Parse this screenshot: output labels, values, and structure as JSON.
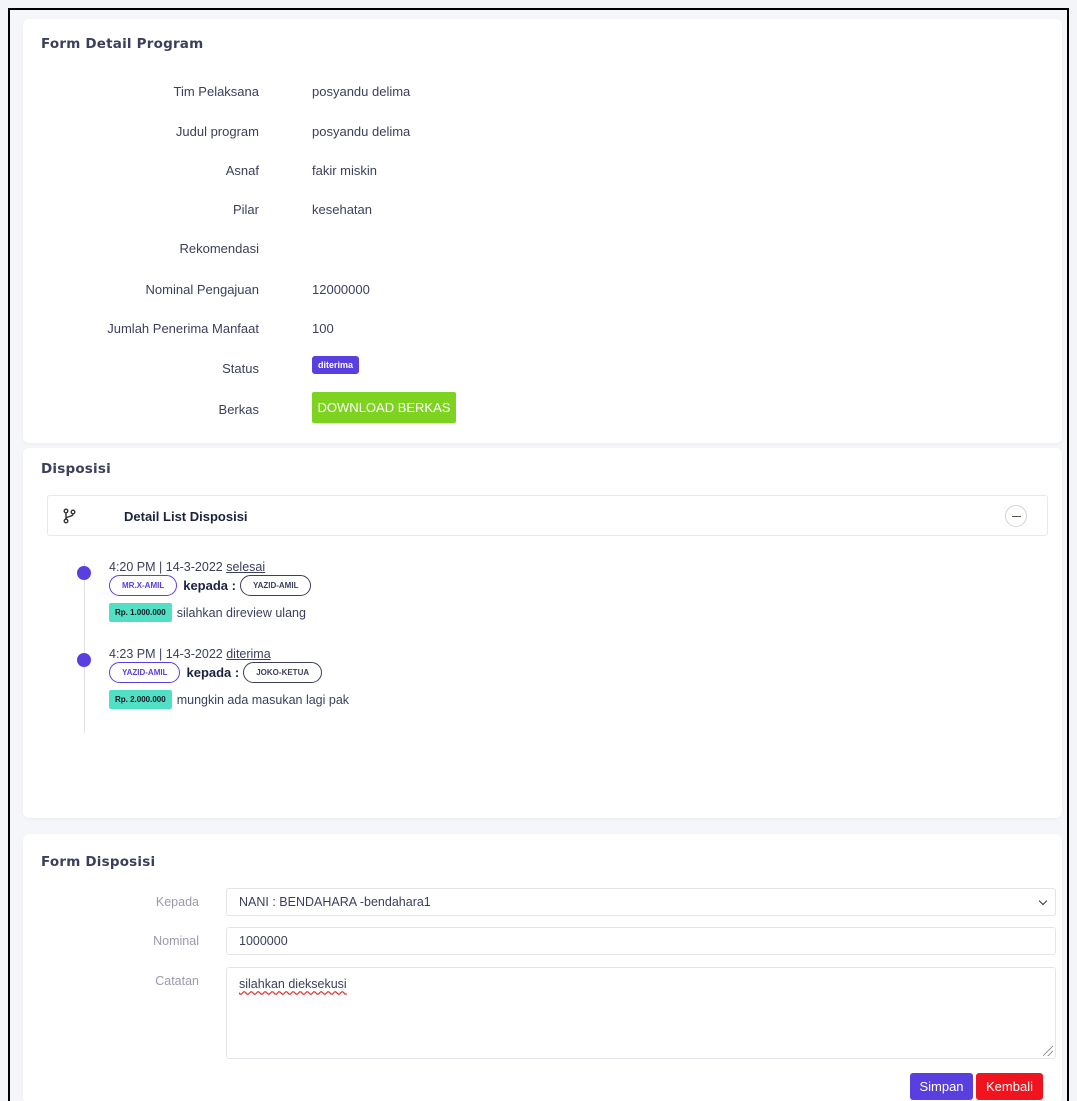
{
  "detail": {
    "title": "Form Detail Program",
    "rows": [
      {
        "label": "Tim Pelaksana",
        "value": "posyandu delima"
      },
      {
        "label": "Judul program",
        "value": "posyandu delima"
      },
      {
        "label": "Asnaf",
        "value": "fakir miskin"
      },
      {
        "label": "Pilar",
        "value": "kesehatan"
      },
      {
        "label": "Rekomendasi",
        "value": ""
      },
      {
        "label": "Nominal Pengajuan",
        "value": "12000000"
      },
      {
        "label": "Jumlah Penerima Manfaat",
        "value": "100"
      }
    ],
    "status_label": "Status",
    "status_value": "diterima",
    "berkas_label": "Berkas",
    "download_label": "DOWNLOAD BERKAS"
  },
  "disposisi": {
    "title": "Disposisi",
    "accordion_title": "Detail List Disposisi",
    "kepada_text": "kepada :",
    "items": [
      {
        "time": "4:20 PM | 14-3-2022",
        "status": "selesai",
        "from": "MR.X-AMIL",
        "to": "YAZID-AMIL",
        "amount": "Rp. 1.000.000",
        "note": "silahkan direview ulang"
      },
      {
        "time": "4:23 PM | 14-3-2022",
        "status": "diterima",
        "from": "YAZID-AMIL",
        "to": "JOKO-KETUA",
        "amount": "Rp. 2.000.000",
        "note": "mungkin ada masukan lagi pak"
      }
    ]
  },
  "form": {
    "title": "Form Disposisi",
    "kepada_label": "Kepada",
    "kepada_value": "NANI : BENDAHARA -bendahara1",
    "nominal_label": "Nominal",
    "nominal_value": "1000000",
    "catatan_label": "Catatan",
    "catatan_value": "silahkan dieksekusi",
    "save_label": "Simpan",
    "back_label": "Kembali"
  },
  "colors": {
    "primary": "#5a3fe0",
    "success": "#7ed321",
    "danger": "#f0141e",
    "amount_badge": "#52e0c4"
  }
}
